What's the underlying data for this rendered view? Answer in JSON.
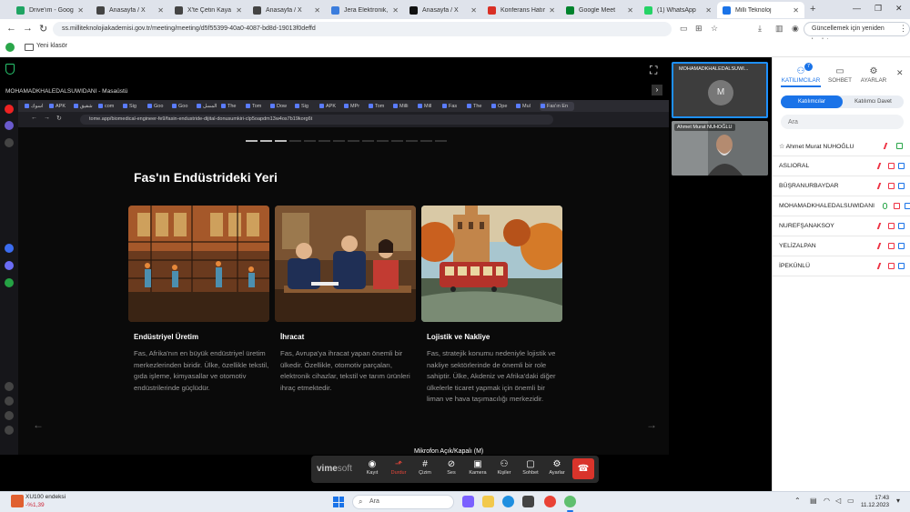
{
  "browser": {
    "tabs": [
      {
        "label": "Drive'ım - Google",
        "color": "#1fa463"
      },
      {
        "label": "Anasayfa / X",
        "color": "#444444"
      },
      {
        "label": "X'te Çetin Kaya K",
        "color": "#444444"
      },
      {
        "label": "Anasayfa / X",
        "color": "#444444"
      },
      {
        "label": "Jera Elektronik, C",
        "color": "#3b7ddd"
      },
      {
        "label": "Anasayfa / X",
        "color": "#111111"
      },
      {
        "label": "Konferans Hatırla",
        "color": "#d93025"
      },
      {
        "label": "Google Meet",
        "color": "#00832d"
      },
      {
        "label": "(1) WhatsApp",
        "color": "#25d366"
      },
      {
        "label": "Milli Teknoloj",
        "color": "#1a73e8"
      }
    ],
    "new_tab": "+",
    "url": "ss.milliteknolojiakademisi.gov.tr/meeting/meeting/d5f55399-40a0-4087-bd8d-19013f0deffd",
    "update_button": "Güncellemek için yeniden başlat",
    "bookmark_folder": "Yeni klasör"
  },
  "meeting": {
    "share_label": "MOHAMADKHALEDALSUWIDANI - Masaüstü",
    "tooltip": "Mikrofon Açık/Kapalı (M)",
    "logo_main": "vime",
    "logo_sub": "soft",
    "toolbar": [
      {
        "label": "Kayıt",
        "icon": "◉",
        "red": false
      },
      {
        "label": "Durdur",
        "icon": "⬏",
        "red": true
      },
      {
        "label": "Çizim",
        "icon": "#",
        "red": false
      },
      {
        "label": "Ses",
        "icon": "⊘",
        "red": false
      },
      {
        "label": "Kamera",
        "icon": "▣",
        "red": false
      },
      {
        "label": "Kişiler",
        "icon": "⚇",
        "red": false
      },
      {
        "label": "Sohbet",
        "icon": "▢",
        "red": false
      },
      {
        "label": "Ayarlar",
        "icon": "⚙",
        "red": false
      }
    ],
    "hangup_icon": "☎",
    "tile1_name": "MOHAMADKHALEDALSUWI...",
    "tile1_initial": "M",
    "tile2_name": "Ahmet Murat NUHOĞLU"
  },
  "shared_screen": {
    "inner_tabs": [
      "اسوك",
      "APK",
      "شقيق",
      "com",
      "Sig",
      "Goo",
      "Goo",
      "المسل",
      "The",
      "Tom",
      "Dow",
      "Sig",
      "APK",
      "MPr",
      "Tom",
      "Milli",
      "Mill",
      "Fas",
      "The",
      "Ope",
      "Mul",
      "Fas'ın En"
    ],
    "inner_url": "tome.app/biomedical-engineer-fe9/fasin-endustride-dijital-donusumkiri-clp5oapdm13w4os7b19korg6t",
    "slide_title": "Fas'ın Endüstrideki Yeri",
    "cards": [
      {
        "title": "Endüstriyel Üretim",
        "text": "Fas, Afrika'nın en büyük endüstriyel üretim merkezlerinden biridir. Ülke, özellikle tekstil, gıda işleme, kimyasallar ve otomotiv endüstrilerinde güçlüdür."
      },
      {
        "title": "İhracat",
        "text": "Fas, Avrupa'ya ihracat yapan önemli bir ülkedir. Özellikle, otomotiv parçaları, elektronik cihazlar, tekstil ve tarım ürünleri ihraç etmektedir."
      },
      {
        "title": "Lojistik ve Nakliye",
        "text": "Fas, stratejik konumu nedeniyle lojistik ve nakliye sektörlerinde de önemli bir role sahiptir. Ülke, Akdeniz ve Afrika'daki diğer ülkelerle ticaret yapmak için önemli bir liman ve hava taşımacılığı merkezidir."
      }
    ]
  },
  "panel": {
    "tabs": [
      {
        "label": "KATILIMCILAR",
        "icon": "⚇"
      },
      {
        "label": "SOHBET",
        "icon": "▭"
      },
      {
        "label": "AYARLAR",
        "icon": "⚙"
      }
    ],
    "badge": "7",
    "segment_active": "Katılımcılar",
    "segment_other": "Katılımcı Davet",
    "search_placeholder": "Ara",
    "participants": [
      {
        "name": "☆ Ahmet Murat NUHOĞLU",
        "host": true
      },
      {
        "name": "ASLIORAL",
        "host": false
      },
      {
        "name": "BÜŞRANURBAYDAR",
        "host": false
      },
      {
        "name": "MOHAMADKHALEDALSUWIDANI",
        "host": false
      },
      {
        "name": "NUREFŞANAKSOY",
        "host": false
      },
      {
        "name": "YELİZALPAN",
        "host": false
      },
      {
        "name": "İPEKÜNLÜ",
        "host": false
      }
    ]
  },
  "taskbar": {
    "stock_name": "XU100 endeksi",
    "stock_change": "-%1,39",
    "search_placeholder": "Ara",
    "time": "17:43",
    "date": "11.12.2023"
  }
}
